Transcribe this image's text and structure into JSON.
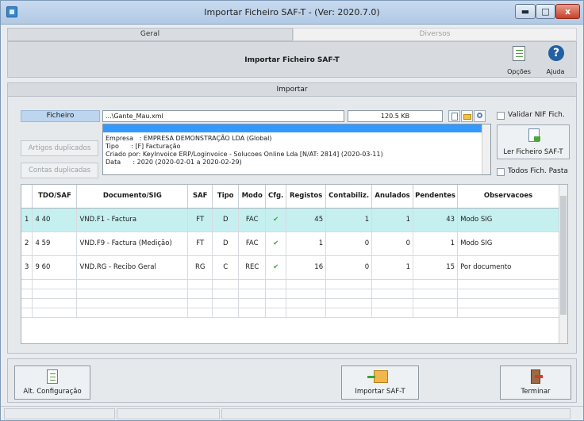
{
  "window": {
    "title": "Importar Ficheiro SAF-T - (Ver: 2020.7.0)",
    "min_label": "▬",
    "max_label": "□",
    "close_label": "x"
  },
  "tabs": [
    {
      "label": "Geral",
      "active": true
    },
    {
      "label": "Diversos",
      "active": false
    }
  ],
  "header": {
    "title": "Importar Ficheiro SAF-T",
    "opcoes_label": "Opções",
    "ajuda_label": "Ajuda",
    "ajuda_glyph": "?"
  },
  "importar": {
    "section_title": "Importar",
    "ficheiro_label": "Ficheiro",
    "file_path": "...\\Gante_Mau.xml",
    "file_size": "120.5 KB",
    "validar_nif_label": "Validar NIF Fich.",
    "todos_fich_label": "Todos Fich. Pasta",
    "artigos_duplicados_label": "Artigos duplicados",
    "contas_duplicadas_label": "Contas duplicadas",
    "ler_ficheiro_label": "Ler Ficheiro SAF-T",
    "info_lines": [
      "Empresa   : EMPRESA DEMONSTRAÇÃO LDA (Global)",
      "Tipo      : [F] Facturação",
      "Criado por: KeyInvoice ERP/Loginvoice - Solucoes Online Lda [N/AT: 2814] (2020-03-11)",
      "Data      : 2020 (2020-02-01 a 2020-02-29)"
    ]
  },
  "table": {
    "columns": [
      "",
      "TDO/SAF",
      "Documento/SIG",
      "SAF",
      "Tipo",
      "Modo",
      "Cfg.",
      "Registos",
      "Contabiliz.",
      "Anulados",
      "Pendentes",
      "Observacoes"
    ],
    "rows": [
      {
        "n": "1",
        "tdo": "4 40",
        "doc": "VND.F1 - Factura",
        "saf": "FT",
        "tipo": "D",
        "modo": "FAC",
        "cfg": "✔",
        "registos": "45",
        "contabiliz": "1",
        "anulados": "1",
        "pendentes": "43",
        "obs": "Modo SIG"
      },
      {
        "n": "2",
        "tdo": "4 59",
        "doc": "VND.F9 - Factura (Medição)",
        "saf": "FT",
        "tipo": "D",
        "modo": "FAC",
        "cfg": "✔",
        "registos": "1",
        "contabiliz": "0",
        "anulados": "0",
        "pendentes": "1",
        "obs": "Modo SIG"
      },
      {
        "n": "3",
        "tdo": "9 60",
        "doc": "VND.RG - Recibo Geral",
        "saf": "RG",
        "tipo": "C",
        "modo": "REC",
        "cfg": "✔",
        "registos": "16",
        "contabiliz": "0",
        "anulados": "1",
        "pendentes": "15",
        "obs": "Por documento"
      }
    ]
  },
  "footer": {
    "alt_configuracao_label": "Alt. Configuração",
    "importar_label": "Importar SAF-T",
    "terminar_label": "Terminar"
  }
}
